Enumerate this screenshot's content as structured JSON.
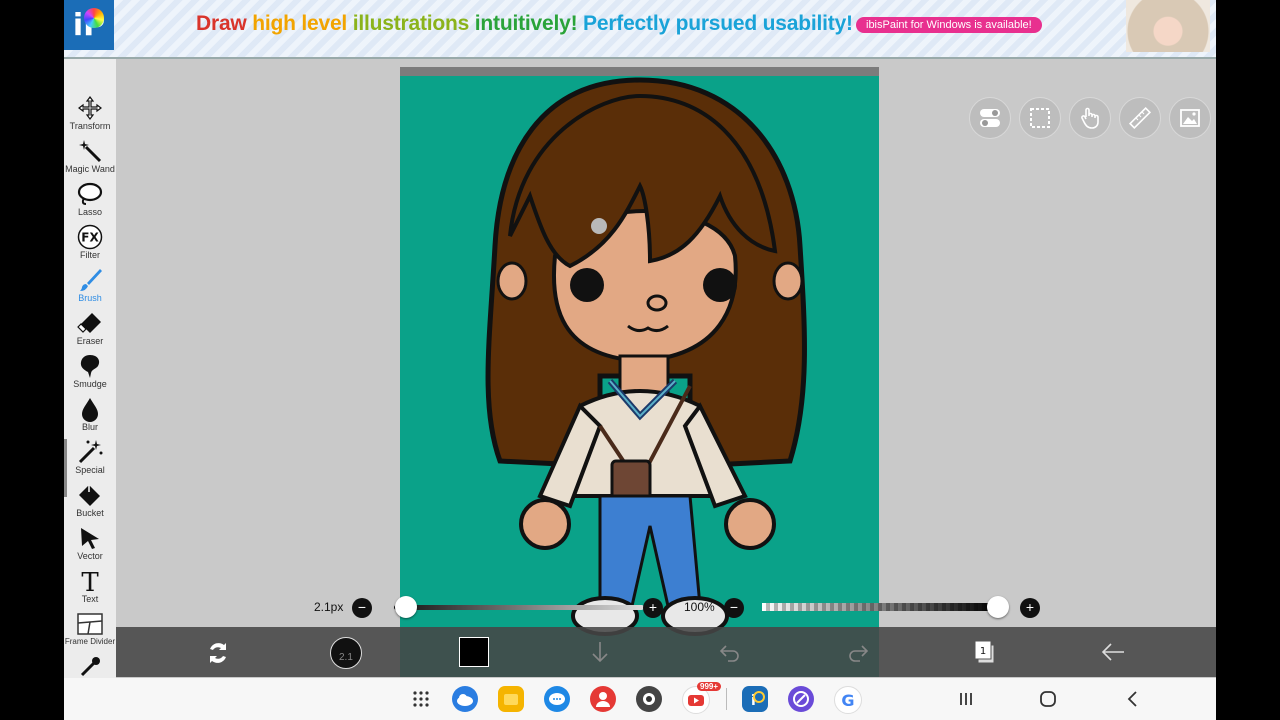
{
  "banner": {
    "logo_text": "iP",
    "headline": {
      "w1": "Draw",
      "w2": "high level",
      "w3": "illustrations",
      "w4": "intuitively!",
      "w5": "Perfectly pursued usability!"
    },
    "pill": "ibisPaint for Windows is available!"
  },
  "toolbar": {
    "items": [
      {
        "label": "Transform",
        "icon": "move-arrows-icon"
      },
      {
        "label": "Magic Wand",
        "icon": "magic-wand-icon"
      },
      {
        "label": "Lasso",
        "icon": "lasso-icon"
      },
      {
        "label": "Filter",
        "icon": "fx-icon"
      },
      {
        "label": "Brush",
        "icon": "brush-icon",
        "active": true
      },
      {
        "label": "Eraser",
        "icon": "eraser-icon"
      },
      {
        "label": "Smudge",
        "icon": "smudge-icon"
      },
      {
        "label": "Blur",
        "icon": "blur-drop-icon"
      },
      {
        "label": "Special",
        "icon": "special-sparkle-icon"
      },
      {
        "label": "Bucket",
        "icon": "bucket-icon"
      },
      {
        "label": "Vector",
        "icon": "vector-cursor-icon"
      },
      {
        "label": "Text",
        "icon": "text-icon"
      },
      {
        "label": "Frame Divider",
        "icon": "frame-divider-icon"
      }
    ]
  },
  "brush_size": {
    "label": "2.1px",
    "value_fraction": 0.03
  },
  "opacity": {
    "label": "100%",
    "value_fraction": 1.0
  },
  "bottom": {
    "brush_badge": "2.1",
    "color": "#000000"
  },
  "colors": {
    "canvas_bg": "#0aa289",
    "active_tool": "#2f8de4",
    "accent_pill": "#e8308f"
  },
  "taskbar": {
    "badge": "999+"
  }
}
